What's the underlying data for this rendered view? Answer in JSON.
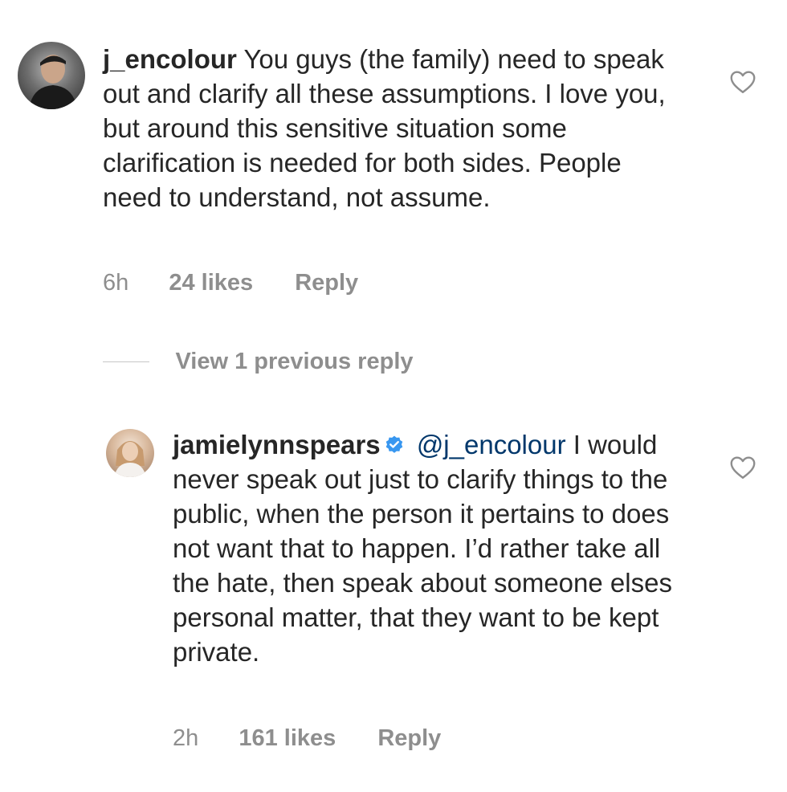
{
  "comments": [
    {
      "username": "j_encolour",
      "verified": false,
      "mention": "",
      "text": "You guys (the family) need to speak out and clarify all these assumptions. I love you, but around this sensitive situation some clarification is needed for both sides. People need to understand, not assume.",
      "time": "6h",
      "likes": "24 likes",
      "reply_label": "Reply"
    },
    {
      "username": "jamielynnspears",
      "verified": true,
      "mention": "@j_encolour",
      "text": "I would never speak out just to clarify things to the public, when the person it pertains to does not want that to happen. I’d rather take all the hate, then speak about someone elses personal matter, that they want to be kept private.",
      "time": "2h",
      "likes": "161 likes",
      "reply_label": "Reply"
    }
  ],
  "view_replies_label": "View 1 previous reply",
  "icons": {
    "like": "heart-outline-icon",
    "verified": "verified-badge-icon"
  },
  "colors": {
    "text": "#262626",
    "secondary": "#8e8e8e",
    "mention": "#00376b",
    "verified": "#3897f0"
  }
}
